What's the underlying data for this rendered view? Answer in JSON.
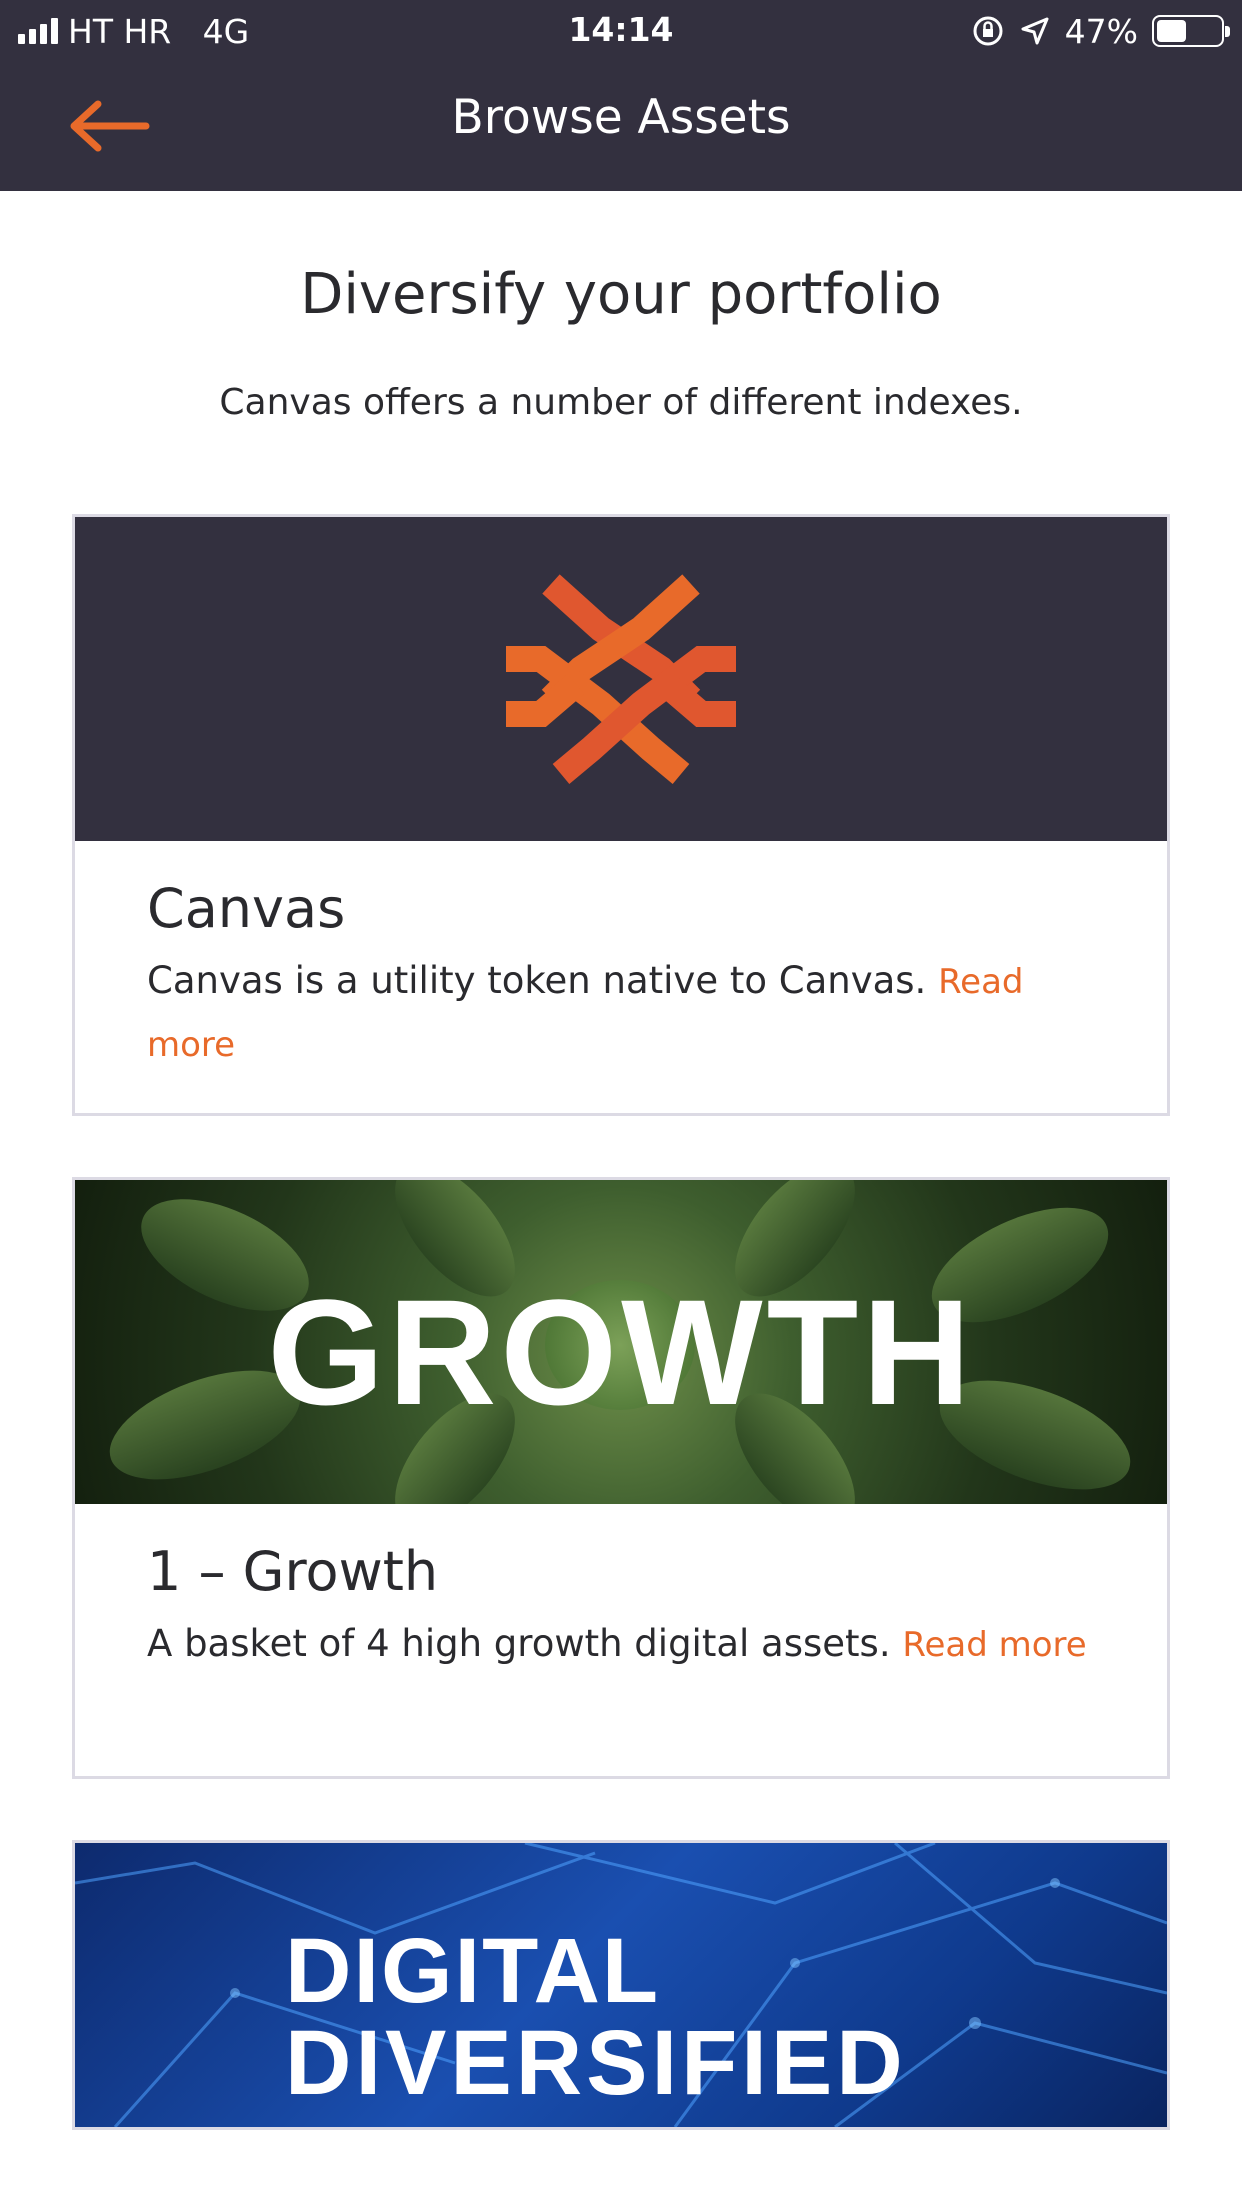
{
  "status_bar": {
    "carrier": "HT HR   4G",
    "time": "14:14",
    "battery_percent": "47%",
    "battery_level": 0.47,
    "icons": [
      "signal-icon",
      "orientation-lock-icon",
      "location-icon",
      "battery-icon"
    ]
  },
  "nav": {
    "title": "Browse Assets",
    "back_icon": "back-arrow-icon",
    "accent_color": "#e86a2a",
    "bar_color": "#33303f"
  },
  "intro": {
    "headline": "Diversify your portfolio",
    "subline": "Canvas offers a number of different indexes."
  },
  "assets": [
    {
      "title": "Canvas",
      "description": "Canvas is a utility token native to Canvas.",
      "read_more": "Read more",
      "banner_icon": "canvas-logo-icon"
    },
    {
      "title": "1 – Growth",
      "description": "A basket of 4 high growth digital assets.",
      "read_more": "Read more",
      "banner_text": "GROWTH"
    },
    {
      "banner_text_line1": "DIGITAL",
      "banner_text_line2": "DIVERSIFIED"
    }
  ]
}
